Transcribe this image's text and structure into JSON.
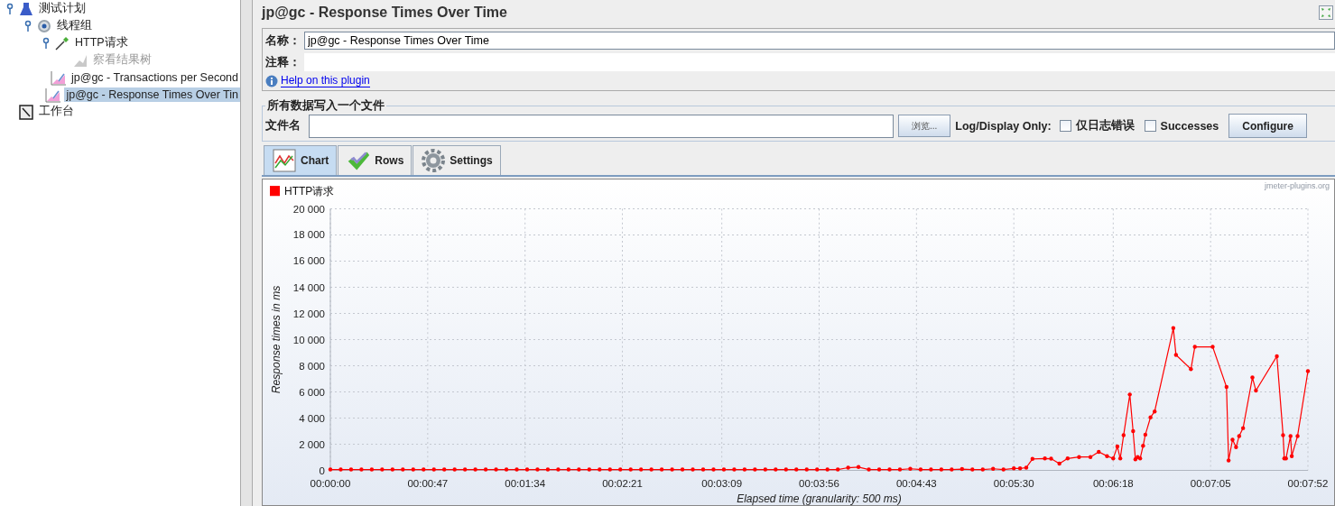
{
  "tree": [
    {
      "label": "测试计划",
      "kind": "plan",
      "expanded": true,
      "disabled": false,
      "selected": false,
      "children": [
        {
          "label": "线程组",
          "kind": "thread-group",
          "expanded": true,
          "disabled": false,
          "selected": false,
          "children": [
            {
              "label": "HTTP请求",
              "kind": "sampler",
              "expanded": true,
              "disabled": false,
              "selected": false,
              "children": [
                {
                  "label": "察看结果树",
                  "kind": "listener",
                  "disabled": true,
                  "selected": false
                }
              ]
            },
            {
              "label": "jp@gc - Transactions per Second",
              "kind": "plugin",
              "disabled": false,
              "selected": false
            },
            {
              "label": "jp@gc - Response Times Over Tin",
              "kind": "plugin",
              "disabled": false,
              "selected": true
            }
          ]
        }
      ]
    },
    {
      "label": "工作台",
      "kind": "workbench",
      "disabled": false,
      "selected": false
    }
  ],
  "panel": {
    "title": "jp@gc - Response Times Over Time",
    "name_label": "名称：",
    "name_value": "jp@gc - Response Times Over Time",
    "comment_label": "注释：",
    "help_link": "Help on this plugin"
  },
  "file_group": {
    "legend": "所有数据写入一个文件",
    "file_label": "文件名",
    "browse_button": "浏览...",
    "log_label": "Log/Display Only:",
    "checkboxes": [
      {
        "label": "仅日志错误",
        "checked": false
      },
      {
        "label": "Successes",
        "checked": false
      }
    ],
    "configure_button": "Configure"
  },
  "tabs": [
    {
      "label": "Chart",
      "kind": "chart",
      "selected": true
    },
    {
      "label": "Rows",
      "kind": "rows",
      "selected": false
    },
    {
      "label": "Settings",
      "kind": "settings",
      "selected": false
    }
  ],
  "chart": {
    "watermark": "jmeter-plugins.org",
    "chart_data": {
      "type": "line",
      "grid": true,
      "xlabel": "Elapsed time (granularity: 500 ms)",
      "ylabel": "Response times in ms",
      "x": [
        0,
        5,
        10,
        15,
        20,
        25,
        30,
        35,
        40,
        45,
        50,
        55,
        60,
        65,
        70,
        75,
        80,
        85,
        90,
        95,
        100,
        105,
        110,
        115,
        120,
        125,
        130,
        135,
        140,
        145,
        150,
        155,
        160,
        165,
        170,
        175,
        180,
        185,
        190,
        195,
        200,
        205,
        210,
        215,
        220,
        225,
        230,
        235,
        240,
        245,
        250,
        255,
        260,
        265,
        270,
        275,
        280,
        285,
        290,
        295,
        300,
        305,
        310,
        315,
        320,
        325,
        330,
        333,
        336,
        339,
        345,
        348,
        352,
        356,
        361.5,
        367,
        371,
        375,
        378,
        380,
        381.4,
        383,
        386,
        387.6,
        388.7,
        389.8,
        391,
        392.4,
        393.5,
        396,
        398,
        407,
        408.3,
        415.5,
        417.4,
        426,
        432.7,
        433.7,
        435.6,
        437.3,
        438.8,
        440.7,
        445.2,
        446.9,
        457,
        460,
        460.6,
        461.4,
        463.6,
        464.2,
        467,
        472
      ],
      "xlim": [
        0,
        472
      ],
      "ylim": [
        0,
        20000
      ],
      "xticks": [
        {
          "value": 0,
          "label": "00:00:00"
        },
        {
          "value": 47,
          "label": "00:00:47"
        },
        {
          "value": 94,
          "label": "00:01:34"
        },
        {
          "value": 141,
          "label": "00:02:21"
        },
        {
          "value": 189,
          "label": "00:03:09"
        },
        {
          "value": 236,
          "label": "00:03:56"
        },
        {
          "value": 283,
          "label": "00:04:43"
        },
        {
          "value": 330,
          "label": "00:05:30"
        },
        {
          "value": 378,
          "label": "00:06:18"
        },
        {
          "value": 425,
          "label": "00:07:05"
        },
        {
          "value": 472,
          "label": "00:07:52"
        }
      ],
      "yticks": [
        {
          "value": 0,
          "label": "0"
        },
        {
          "value": 2000,
          "label": "2 000"
        },
        {
          "value": 4000,
          "label": "4 000"
        },
        {
          "value": 6000,
          "label": "6 000"
        },
        {
          "value": 8000,
          "label": "8 000"
        },
        {
          "value": 10000,
          "label": "10 000"
        },
        {
          "value": 12000,
          "label": "12 000"
        },
        {
          "value": 14000,
          "label": "14 000"
        },
        {
          "value": 16000,
          "label": "16 000"
        },
        {
          "value": 18000,
          "label": "18 000"
        },
        {
          "value": 20000,
          "label": "20 000"
        }
      ],
      "series": [
        {
          "name": "HTTP请求",
          "color": "#ff0000",
          "values": [
            60,
            60,
            60,
            60,
            60,
            60,
            60,
            60,
            60,
            60,
            60,
            60,
            60,
            60,
            60,
            60,
            60,
            60,
            60,
            60,
            60,
            60,
            60,
            60,
            60,
            60,
            60,
            60,
            60,
            60,
            60,
            60,
            60,
            60,
            60,
            60,
            60,
            60,
            60,
            60,
            60,
            60,
            60,
            60,
            60,
            60,
            60,
            60,
            60,
            60,
            200,
            250,
            60,
            60,
            60,
            60,
            120,
            60,
            60,
            60,
            60,
            100,
            60,
            60,
            120,
            60,
            150,
            150,
            200,
            870,
            910,
            890,
            520,
            910,
            1020,
            1020,
            1410,
            1090,
            910,
            1820,
            910,
            2680,
            5800,
            3000,
            840,
            1020,
            910,
            1870,
            2730,
            4050,
            4500,
            10870,
            8830,
            7740,
            9440,
            9440,
            6370,
            750,
            2340,
            1770,
            2620,
            3230,
            7100,
            6100,
            8720,
            2680,
            910,
            910,
            2620,
            1090,
            2620,
            7580
          ]
        }
      ]
    }
  }
}
